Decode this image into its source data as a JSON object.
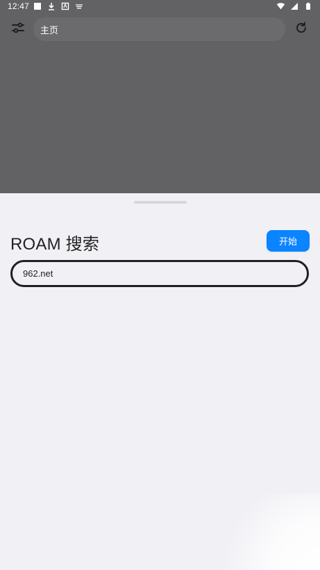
{
  "status_bar": {
    "time": "12:47",
    "left_icons": [
      "square-notification-icon",
      "download-icon",
      "app-notification-icon",
      "cast-icon"
    ],
    "right_icons": [
      "wifi-icon",
      "signal-icon",
      "battery-icon"
    ]
  },
  "toolbar": {
    "left_icon": "settings-sliders-icon",
    "address": "主页",
    "right_icon": "refresh-icon"
  },
  "sheet": {
    "title": "ROAM 搜索",
    "start_label": "开始",
    "search": {
      "value": "962.net",
      "placeholder": ""
    }
  },
  "colors": {
    "dim_overlay": "#626264",
    "sheet_bg": "#f1f0f5",
    "accent": "#0b84ff",
    "input_border": "#1f1f24"
  }
}
